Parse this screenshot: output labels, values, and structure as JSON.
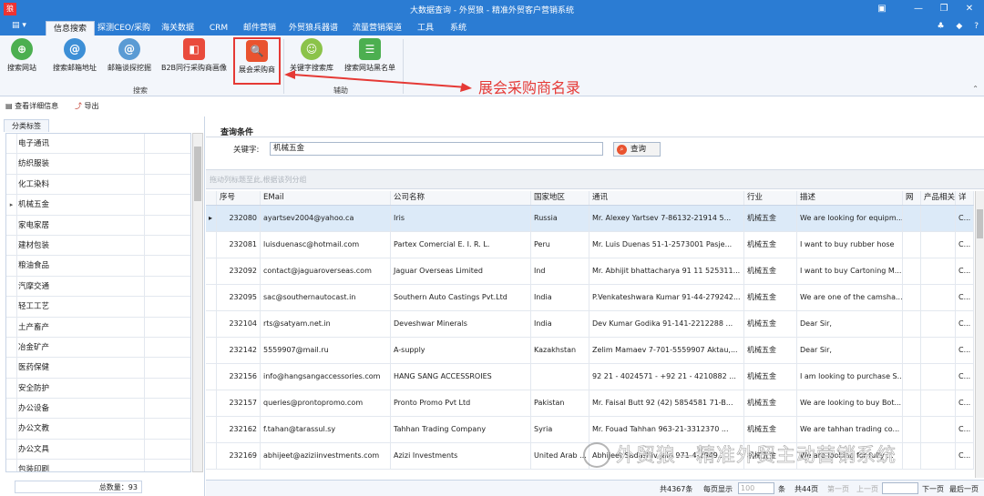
{
  "window": {
    "title": "大数据查询 - 外贸狼 - 精准外贸客户营销系统",
    "logo_text": "狼"
  },
  "menubar": {
    "tabs": [
      "信息搜索",
      "探测CEO/采购",
      "海关数据",
      "CRM",
      "邮件营销",
      "外贸狼兵器谱",
      "流量营销渠道",
      "工具",
      "系统"
    ],
    "active_tab": "信息搜索"
  },
  "ribbon": {
    "buttons": [
      {
        "label": "搜索网站",
        "icon": "globe-search-icon",
        "color": "#4caf50"
      },
      {
        "label": "搜索邮箱地址",
        "icon": "at-icon",
        "color": "#3d8fd6"
      },
      {
        "label": "邮箱谈探挖掘",
        "icon": "email-search-icon",
        "color": "#5a9bd4"
      },
      {
        "label": "B2B同行采购商画像",
        "icon": "b2b-icon",
        "color": "#e94b3c"
      },
      {
        "label": "展会采购商",
        "icon": "exhibition-search-icon",
        "color": "#e9532f"
      },
      {
        "label": "关键字搜索库",
        "icon": "keyword-lib-icon",
        "color": "#8bc34a"
      },
      {
        "label": "搜索网站黑名单",
        "icon": "blacklist-icon",
        "color": "#4caf50"
      }
    ],
    "groups": {
      "search": "搜索",
      "assist": "辅助"
    }
  },
  "annotation": {
    "text": "展会采购商名录"
  },
  "subtoolbar": {
    "view_detail": "查看详细信息",
    "export": "导出"
  },
  "sidebar": {
    "tab": "分类标签",
    "categories": [
      "电子通讯",
      "纺织服装",
      "化工染料",
      "机械五金",
      "家电家居",
      "建材包装",
      "粮油食品",
      "汽摩交通",
      "轻工工艺",
      "土产畜产",
      "冶金矿产",
      "医药保健",
      "安全防护",
      "办公设备",
      "办公文教",
      "办公文具",
      "包装印刷"
    ],
    "selected_index": 3,
    "total_label": "总数量：93"
  },
  "query": {
    "title": "查询条件",
    "keyword_label": "关键字:",
    "keyword_value": "机械五金",
    "button": "查询"
  },
  "grid": {
    "group_hint": "拖动列标题至此,根据该列分组",
    "columns": [
      "序号",
      "EMail",
      "公司名称",
      "国家地区",
      "通讯",
      "行业",
      "描述",
      "网",
      "产品相关",
      "详"
    ],
    "rows": [
      [
        "232080",
        "ayartsev2004@yahoo.ca",
        "Iris",
        "Russia",
        "Mr. Alexey Yartsev  7-86132-21914    5...",
        "机械五金",
        "We are looking for equipm...",
        "",
        "",
        "C..."
      ],
      [
        "232081",
        "luisduenasc@hotmail.com",
        "Partex Comercial E. I. R. L.",
        "Peru",
        "Mr. Luis Duenas  51-1-2573001    Pasje...",
        "机械五金",
        "I want to buy rubber hose",
        "",
        "",
        "C..."
      ],
      [
        "232092",
        "contact@jaguaroverseas.com",
        "Jaguar Overseas Limited",
        "Ind",
        "Mr. Abhijit bhattacharya  91 11 525311...",
        "机械五金",
        "I want to buy Cartoning M...",
        "",
        "",
        "C..."
      ],
      [
        "232095",
        "sac@southernautocast.in",
        "Southern Auto Castings Pvt.Ltd",
        "India",
        "P.Venkateshwara Kumar  91-44-279242...",
        "机械五金",
        "We are one of the camsha...",
        "",
        "",
        "C..."
      ],
      [
        "232104",
        "rts@satyam.net.in",
        "Deveshwar Minerals",
        "India",
        "Dev Kumar Godika  91-141-2212288    ...",
        "机械五金",
        "Dear Sir,",
        "",
        "",
        "C..."
      ],
      [
        "232142",
        "5559907@mail.ru",
        "A-supply",
        "Kazakhstan",
        "Zelim Mamaev  7-701-5559907    Aktau,...",
        "机械五金",
        "Dear Sir,",
        "",
        "",
        "C..."
      ],
      [
        "232156",
        "info@hangsangaccessories.com",
        "HANG SANG ACCESSROIES",
        "",
        "92 21 - 4024571 - +92 21 - 4210882 ...",
        "机械五金",
        "I am looking to purchase S...",
        "",
        "",
        "C..."
      ],
      [
        "232157",
        "queries@prontopromo.com",
        "Pronto Promo Pvt Ltd",
        "Pakistan",
        "Mr. Faisal Butt  92 (42) 5854581    71-B...",
        "机械五金",
        "We are looking to buy Bot...",
        "",
        "",
        "C..."
      ],
      [
        "232162",
        "f.tahan@tarassul.sy",
        "Tahhan Trading Company",
        "Syria",
        "Mr. Fouad Tahhan  963-21-3312370    ...",
        "机械五金",
        "We are tahhan trading co...",
        "",
        "",
        "C..."
      ],
      [
        "232169",
        "abhijeet@aziziinvestments.com",
        "Azizi Investments",
        "United Arab ...",
        "Abhijeet Sadashiv Jain  971-4-2949...",
        "机械五金",
        "We are looking for fully ...",
        "",
        "",
        "C..."
      ]
    ],
    "selected_row": 0
  },
  "pager": {
    "total": "共4367条",
    "per_page_label": "每页显示",
    "per_page_value": "100",
    "unit": "条",
    "pages": "共44页",
    "first": "第一页",
    "prev": "上一页",
    "next": "下一页",
    "last": "最后一页"
  },
  "watermark": {
    "text": "外贸狼—精准外贸主动营销系统"
  }
}
